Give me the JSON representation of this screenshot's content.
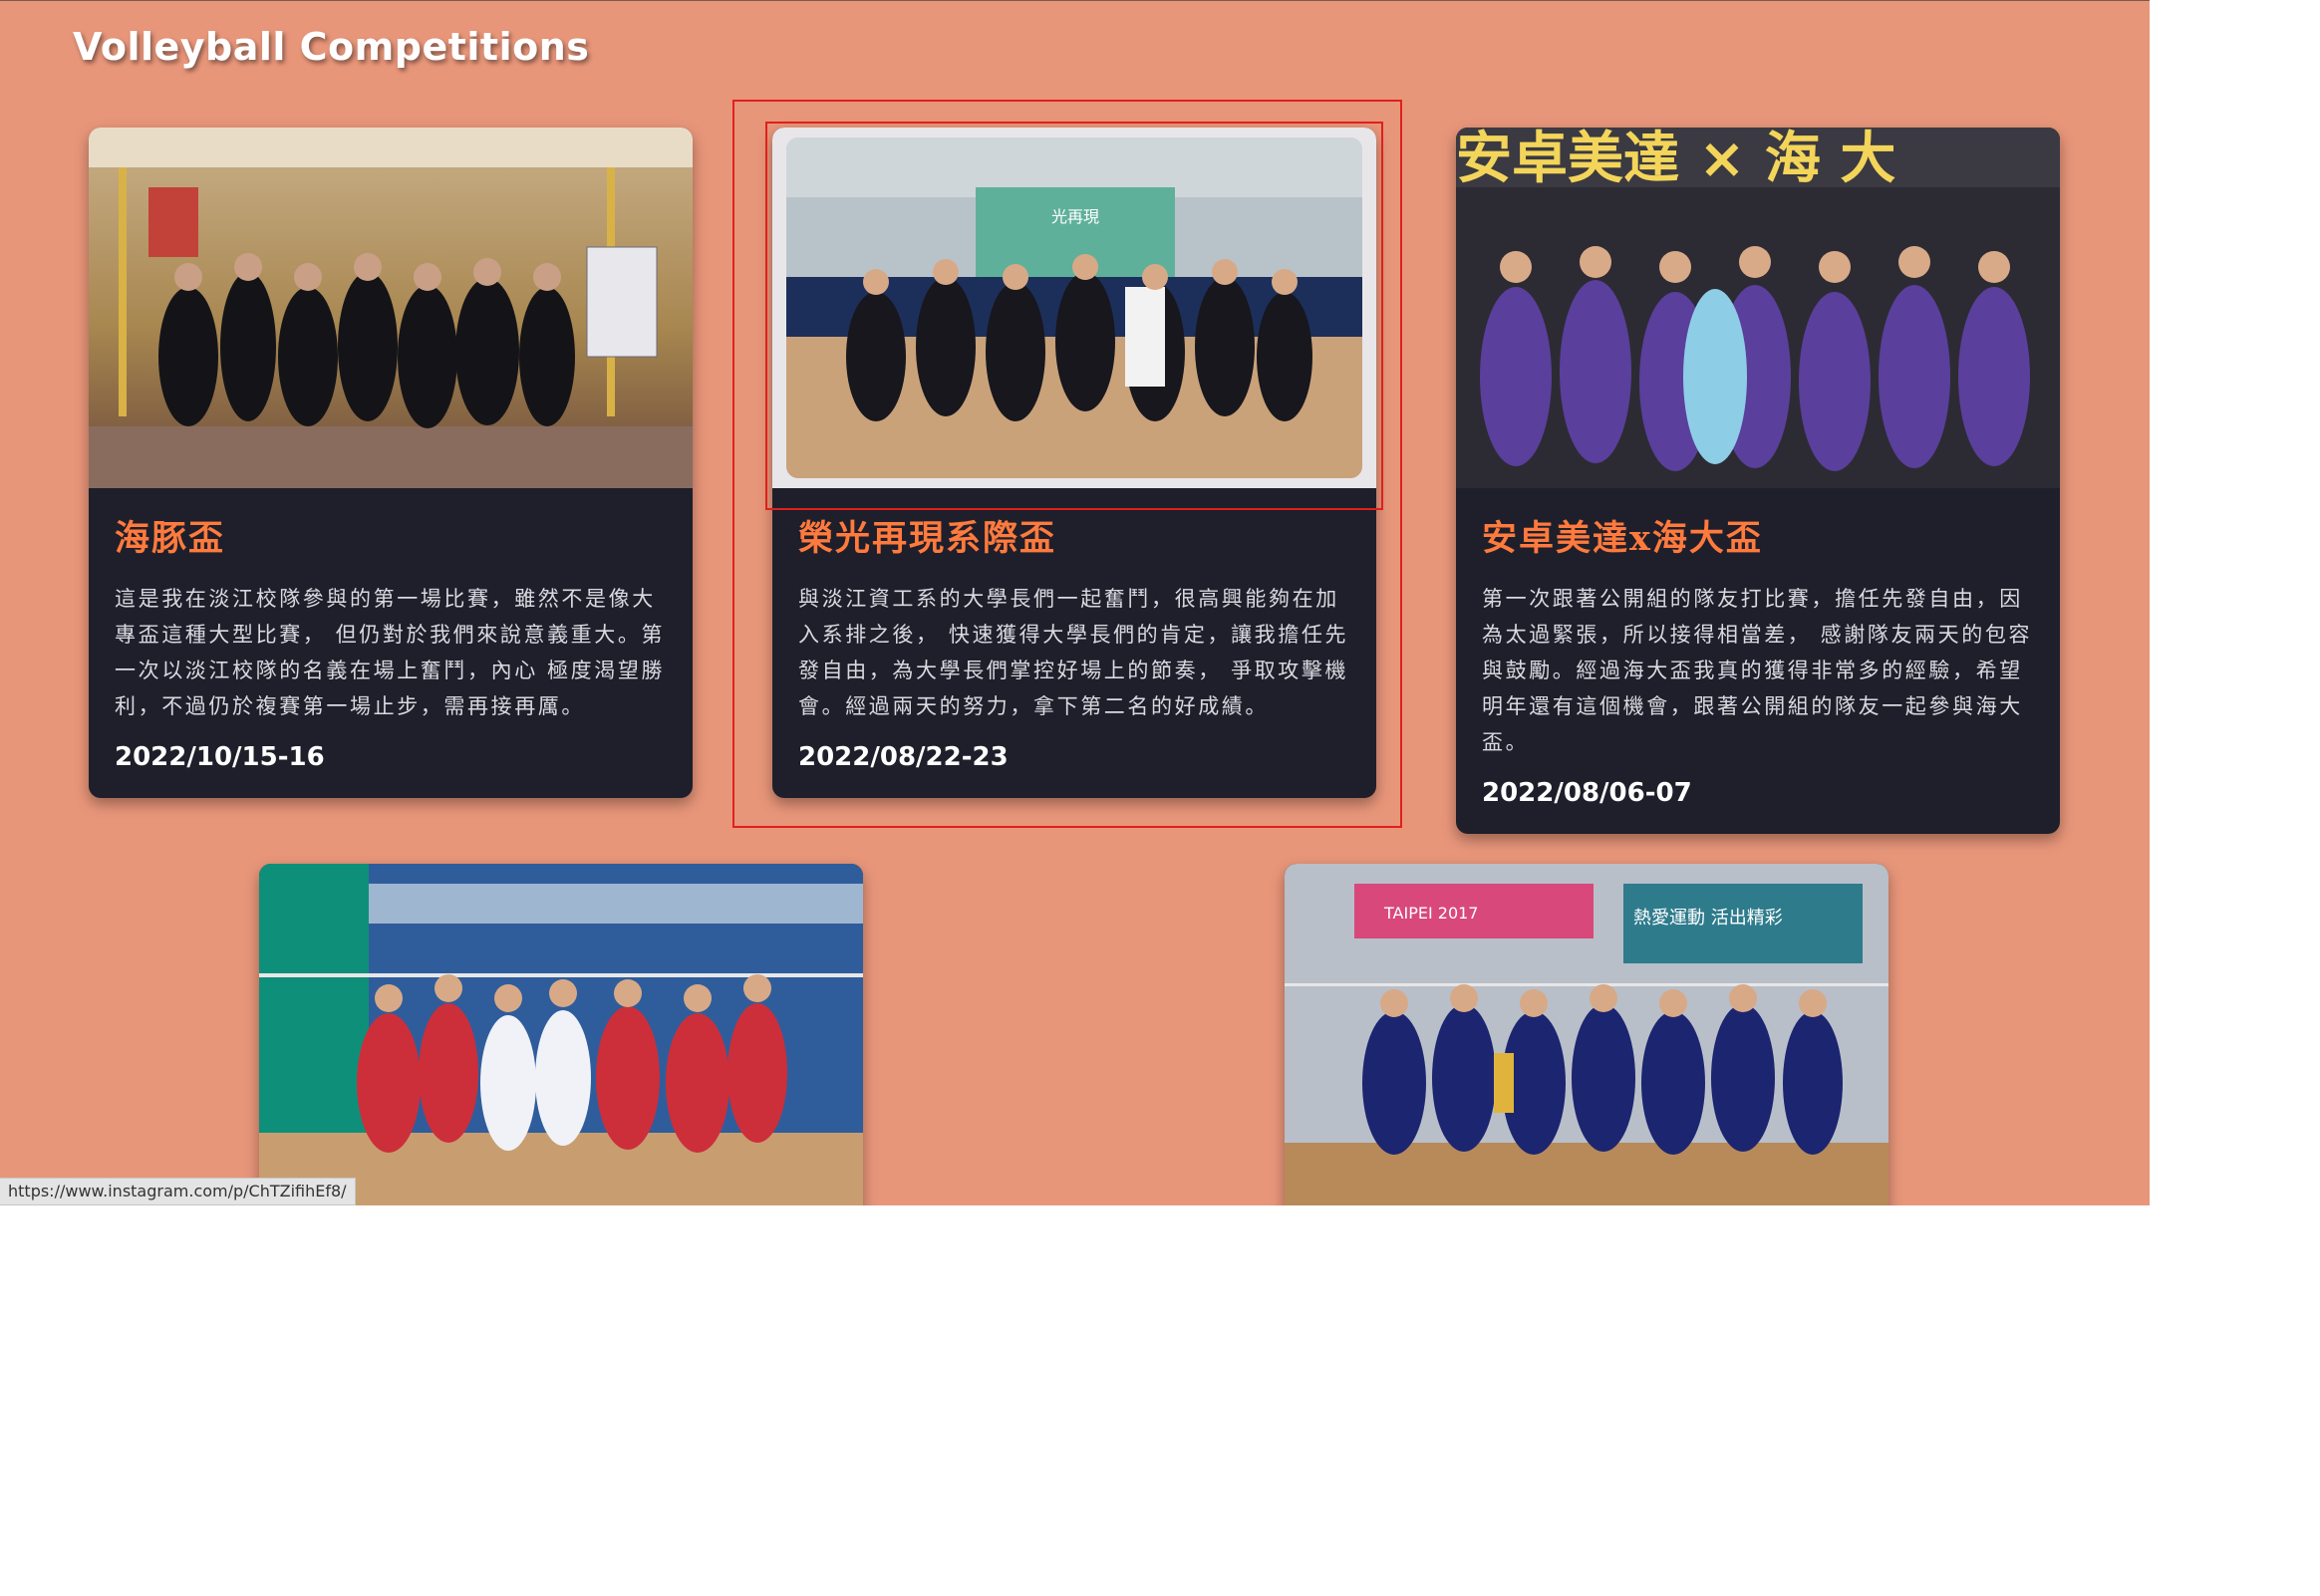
{
  "page": {
    "title": "Volleyball Competitions"
  },
  "cards": [
    {
      "title": "海豚盃",
      "description": "這是我在淡江校隊參與的第一場比賽，雖然不是像大專盃這種大型比賽， 但仍對於我們來說意義重大。第一次以淡江校隊的名義在場上奮鬥，內心 極度渴望勝利，不過仍於複賽第一場止步，需再接再厲。",
      "date": "2022/10/15-16"
    },
    {
      "title": "榮光再現系際盃",
      "description": "與淡江資工系的大學長們一起奮鬥，很高興能夠在加入系排之後， 快速獲得大學長們的肯定，讓我擔任先發自由，為大學長們掌控好場上的節奏， 爭取攻擊機會。經過兩天的努力，拿下第二名的好成績。",
      "date": "2022/08/22-23"
    },
    {
      "title": "安卓美達x海大盃",
      "description": "第一次跟著公開組的隊友打比賽，擔任先發自由，因為太過緊張，所以接得相當差， 感謝隊友兩天的包容與鼓勵。經過海大盃我真的獲得非常多的經驗，希望明年還有這個機會，跟著公開組的隊友一起參與海大盃。",
      "date": "2022/08/06-07"
    }
  ],
  "banner_texts": {
    "card3_banner": "安卓美達 × 海 大",
    "card2_banner": "光再現",
    "card5_banner_left": "TAIPEI 2017",
    "card5_banner_right": "熱愛運動 活出精彩"
  },
  "status_bar": {
    "url": "https://www.instagram.com/p/ChTZifihEf8/"
  }
}
